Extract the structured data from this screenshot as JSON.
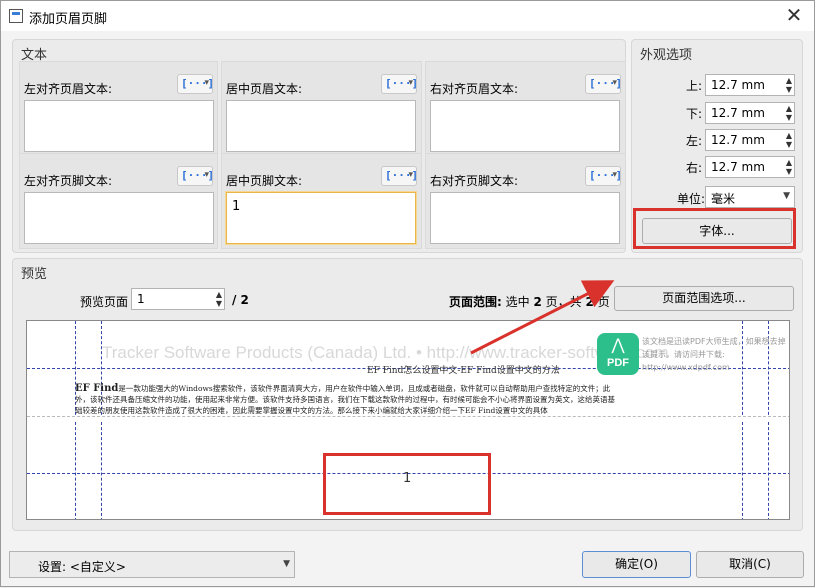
{
  "window": {
    "title": "添加页眉页脚",
    "close_symbol": "✕"
  },
  "text_panel": {
    "title": "文本",
    "macro_icon": "[···]",
    "macro_arrow": "▾",
    "header": {
      "left": {
        "label": "左对齐页眉文本:",
        "value": ""
      },
      "center": {
        "label": "居中页眉文本:",
        "value": ""
      },
      "right": {
        "label": "右对齐页眉文本:",
        "value": ""
      }
    },
    "footer": {
      "left": {
        "label": "左对齐页脚文本:",
        "value": ""
      },
      "center": {
        "label": "居中页脚文本:",
        "value": "1"
      },
      "right": {
        "label": "右对齐页脚文本:",
        "value": ""
      }
    }
  },
  "appearance": {
    "title": "外观选项",
    "top": {
      "label": "上:",
      "value": "12.7 mm"
    },
    "bottom": {
      "label": "下:",
      "value": "12.7 mm"
    },
    "left": {
      "label": "左:",
      "value": "12.7 mm"
    },
    "right": {
      "label": "右:",
      "value": "12.7 mm"
    },
    "unit": {
      "label": "单位:",
      "value": "毫米"
    },
    "font_button": "字体..."
  },
  "preview": {
    "title": "预览",
    "page_label": "预览页面",
    "page_value": "1",
    "page_total": "/ 2",
    "range_label": "页面范围:",
    "range_text_pre": "选中",
    "range_selected": "2",
    "range_text_mid": "页，共",
    "range_total": "2",
    "range_text_post": "页",
    "range_button": "页面范围选项...",
    "watermark": "Tracker Software Products (Canada) Ltd. • http://www.tracker-software.com",
    "doc_header": "EF Find怎么设置中文-EF Find设置中文的方法",
    "doc_lead": "EF Find",
    "doc_body": "是一款功能强大的Windows搜索软件，该软件界面清爽大方，用户在软件中输入单词，且成或者磁盘，软件就可以自动帮助用户查找特定的文件；此外，该软件还具备压缩文件的功能，使用起来非常方便。该软件支持多国语言，我们在下载这款软件的过程中，有时候可能会不小心将界面设置为英文，这给英语基础较差的朋友使用这款软件造成了很大的困难，因此需要掌握设置中文的方法。那么接下来小编就给大家详细介绍一下EF Find设置中文的具体",
    "footer_number": "1",
    "pdf_logo_text": "PDF",
    "pdf_note": "该文档是迅读PDF大师生成，如果想去掉该提示，请访问并下载: http://www.xdpdf.com"
  },
  "bottom_bar": {
    "settings_label": "设置:",
    "settings_value": "<自定义>",
    "ok_button": "确定(O)",
    "cancel_button": "取消(C)"
  },
  "colors": {
    "accent": "#2a6fd6",
    "highlight_red": "#d9312b",
    "focus_border": "#e9b64a"
  }
}
